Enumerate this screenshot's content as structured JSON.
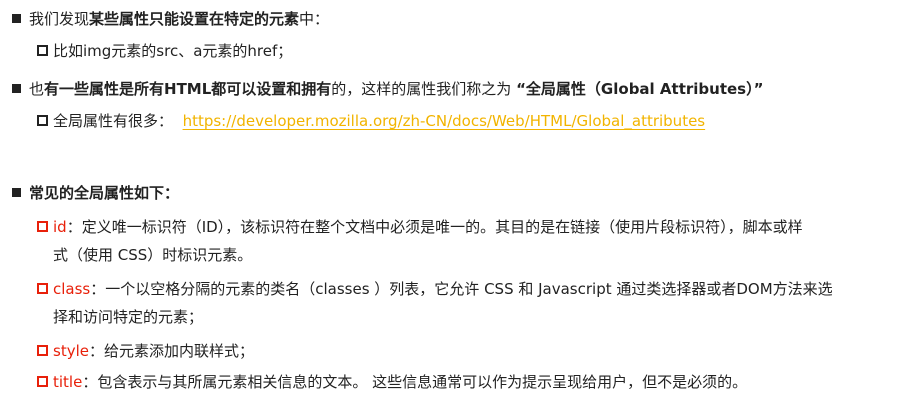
{
  "colors": {
    "text": "#222222",
    "accent_red": "#e8200a",
    "link": "#f2b400"
  },
  "icons": {
    "level1": "filled-square-bullet",
    "level2": "hollow-square-bullet"
  },
  "section1": {
    "pre": "我们发现",
    "bold": "某些属性只能设置在特定的元素",
    "post": "中：",
    "sub": "比如img元素的src、a元素的href；"
  },
  "section2": {
    "pre": "也",
    "bold": "有一些属性是所有HTML都可以设置和拥有",
    "mid": "的，这样的属性我们称之为 ",
    "quote": "“全局属性（Global Attributes）”",
    "sub_label": "全局属性有很多：",
    "link": "https://developer.mozilla.org/zh-CN/docs/Web/HTML/Global_attributes"
  },
  "section3": {
    "heading": "常见的全局属性如下：",
    "items": [
      {
        "term": "id",
        "desc1": "：定义唯一标识符（ID），该标识符在整个文档中必须是唯一的。其目的是在链接（使用片段标识符），脚本或样",
        "desc2": "式（使用 CSS）时标识元素。"
      },
      {
        "term": "class",
        "desc1": "：一个以空格分隔的元素的类名（classes ）列表，它允许 CSS 和 Javascript 通过类选择器或者DOM方法来选",
        "desc2": "择和访问特定的元素；"
      },
      {
        "term": "style",
        "desc1": "：给元素添加内联样式；"
      },
      {
        "term": "title",
        "desc1": "：包含表示与其所属元素相关信息的文本。 这些信息通常可以作为提示呈现给用户，但不是必须的。"
      }
    ]
  }
}
